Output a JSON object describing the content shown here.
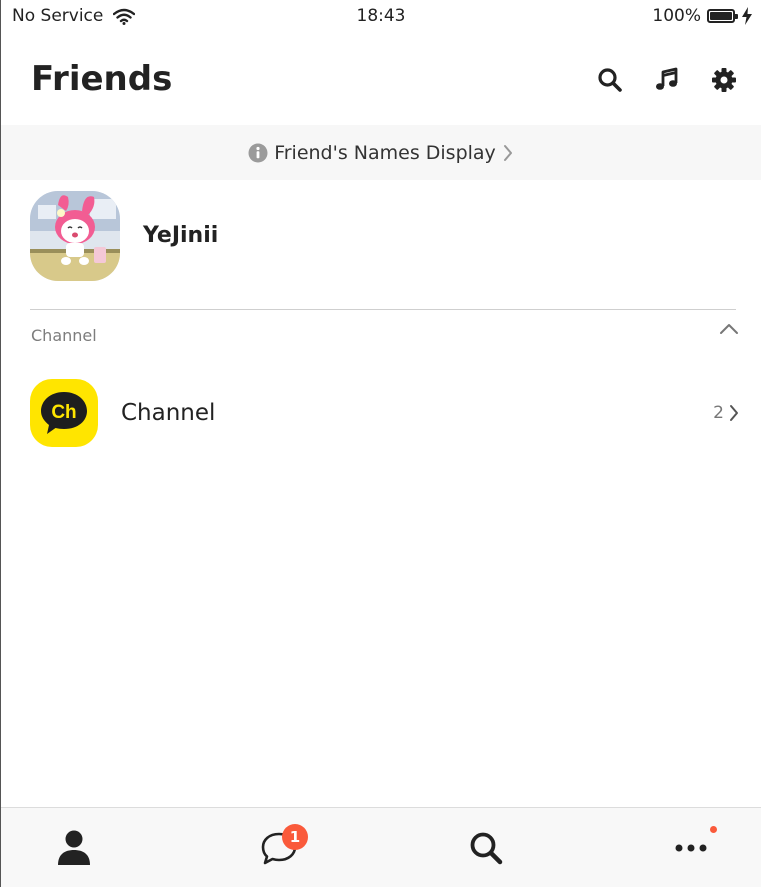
{
  "status_bar": {
    "carrier": "No Service",
    "time": "18:43",
    "battery": "100%"
  },
  "header": {
    "title": "Friends",
    "icons": [
      "search-icon",
      "music-icon",
      "settings-icon"
    ]
  },
  "names_banner": {
    "label": "Friend's Names Display"
  },
  "profile": {
    "name": "YeJinii"
  },
  "channel_section": {
    "title": "Channel",
    "item": {
      "logo_text": "Ch",
      "label": "Channel",
      "count": "2"
    }
  },
  "tab_bar": {
    "tabs": [
      "friends-tab",
      "chats-tab",
      "search-tab",
      "more-tab"
    ],
    "chats_badge": "1"
  },
  "colors": {
    "accent_badge": "#fa5a3b",
    "channel_yellow": "#ffe500"
  }
}
